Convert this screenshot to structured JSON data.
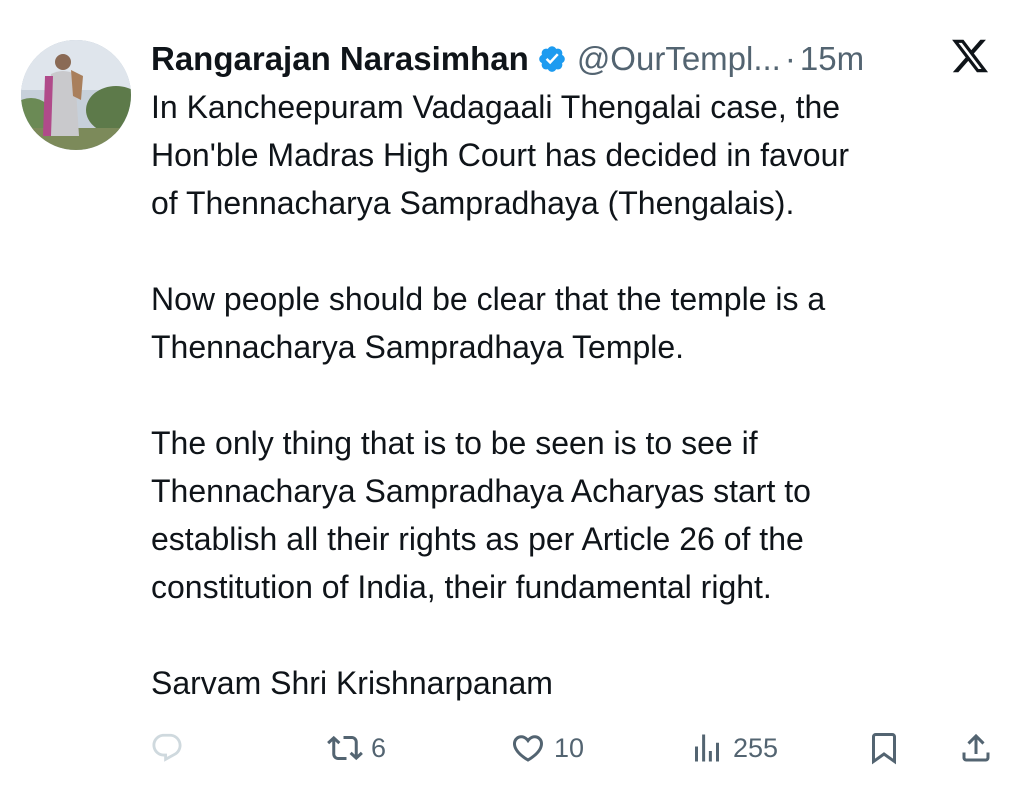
{
  "tweet": {
    "author_name": "Rangarajan Narasimhan",
    "handle": "@OurTempl...",
    "separator": "·",
    "time": "15m",
    "paragraphs": [
      "In Kancheepuram Vadagaali Thengalai case, the\nHon'ble Madras High Court has decided in favour\nof Thennacharya Sampradhaya (Thengalais).",
      "Now people should be clear that the temple is a\nThennacharya Sampradhaya Temple.",
      "The only thing that is to be seen is to see if\nThennacharya Sampradhaya Acharyas start to\nestablish all their rights as per Article 26 of the\nconstitution of India, their fundamental right.",
      "Sarvam Shri Krishnarpanam"
    ]
  },
  "actions": {
    "reply": {
      "icon": "reply-icon",
      "count": ""
    },
    "retweet": {
      "icon": "retweet-icon",
      "count": "6"
    },
    "like": {
      "icon": "heart-icon",
      "count": "10"
    },
    "views": {
      "icon": "views-icon",
      "count": "255"
    },
    "bookmark": {
      "icon": "bookmark-icon"
    },
    "share": {
      "icon": "share-icon"
    }
  },
  "colors": {
    "text": "#0f1419",
    "muted": "#536471",
    "verified": "#1d9bf0",
    "reply_icon_faded": "#cfd9de"
  },
  "icons": {
    "verified": "verified-badge-icon",
    "brand": "x-logo-icon"
  }
}
